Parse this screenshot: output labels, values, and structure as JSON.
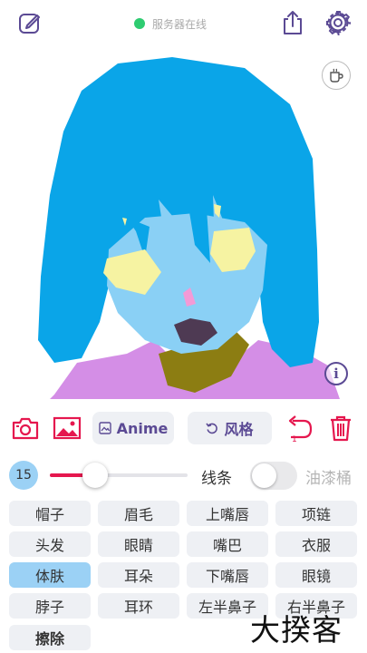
{
  "status": {
    "text": "服务器在线",
    "color": "#2ecc71"
  },
  "icons": {
    "edit": "edit-square-icon",
    "share": "share-icon",
    "settings": "gear-icon",
    "mug": "mug-icon",
    "info": "info-icon",
    "camera": "camera-icon",
    "image": "image-icon",
    "undo": "undo-icon",
    "trash": "trash-icon"
  },
  "info_label": "i",
  "toolbar": {
    "anime_label": "Anime",
    "style_label": "风格",
    "undo_badge": "1"
  },
  "brush": {
    "size": "15",
    "level": 0.33
  },
  "mode": {
    "left": "线条",
    "right": "油漆桶",
    "toggle_on": false
  },
  "parts": [
    "帽子",
    "眉毛",
    "上嘴唇",
    "项链",
    "头发",
    "眼睛",
    "嘴巴",
    "衣服",
    "体肤",
    "耳朵",
    "下嘴唇",
    "眼镜",
    "脖子",
    "耳环",
    "左半鼻子",
    "右半鼻子"
  ],
  "active_part": "体肤",
  "erase_label": "擦除",
  "watermark": "大揆客",
  "colors": {
    "accent": "#5b4a94",
    "danger": "#e5174e",
    "active": "#9bd1f5",
    "pill": "#eef0f4"
  }
}
